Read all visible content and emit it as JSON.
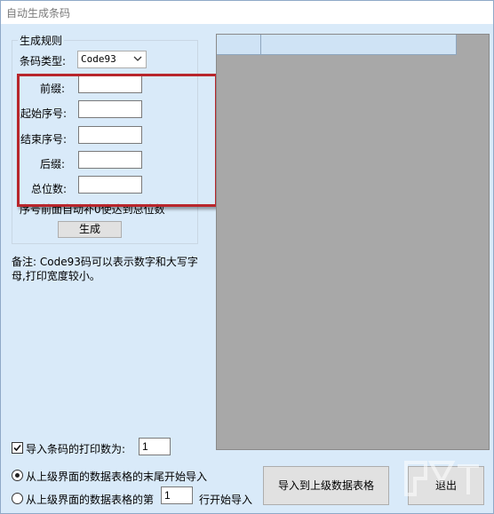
{
  "window": {
    "title": "自动生成条码"
  },
  "rules": {
    "group_title": "生成规则",
    "barcode_type_label": "条码类型:",
    "barcode_type_value": "Code93",
    "prefix_label": "前缀:",
    "prefix_value": "",
    "start_label": "起始序号:",
    "start_value": "",
    "end_label": "结束序号:",
    "end_value": "",
    "suffix_label": "后缀:",
    "suffix_value": "",
    "digits_label": "总位数:",
    "digits_value": "",
    "hint": "序号前面自动补0使达到总位数",
    "generate_label": "生成"
  },
  "note": {
    "text": "备注: Code93码可以表示数字和大写字母,打印宽度较小。"
  },
  "options": {
    "print_count_label": "导入条码的打印数为:",
    "print_count_value": "1",
    "print_count_checked": true,
    "radio_end_label": "从上级界面的数据表格的末尾开始导入",
    "radio_row_prefix": "从上级界面的数据表格的第",
    "radio_row_value": "1",
    "radio_row_suffix": "行开始导入",
    "selected_radio": "end"
  },
  "actions": {
    "import_label": "导入到上级数据表格",
    "exit_label": "退出"
  },
  "icons": {
    "dropdown": "chevron-down-icon",
    "check": "check-icon",
    "watermark": "logo-icon"
  },
  "colors": {
    "window_bg": "#d9eaf9",
    "highlight_box": "#b8262c",
    "grid_bg": "#a8a8a8"
  }
}
